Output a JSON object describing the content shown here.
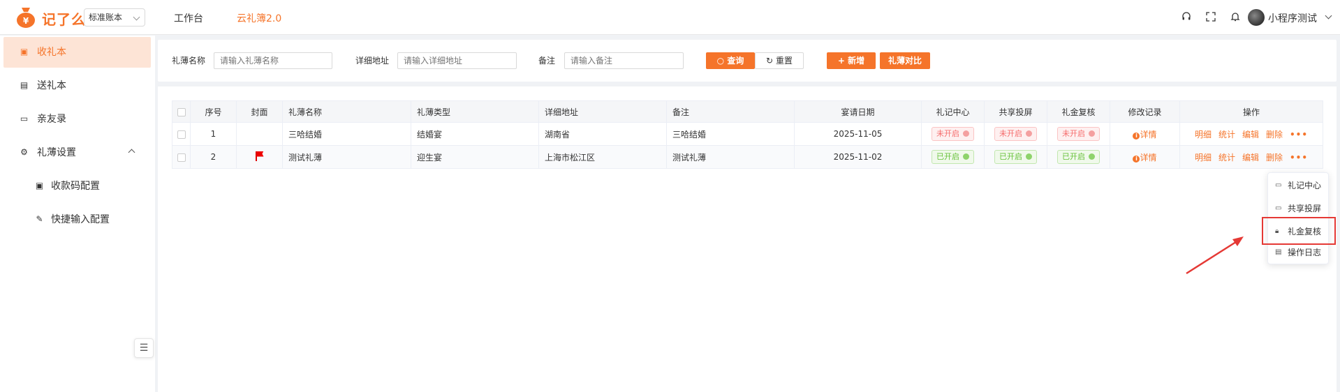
{
  "app": {
    "logo_text": "记了么",
    "book_select": "标准账本",
    "accent_color": "#f5742a"
  },
  "nav": {
    "workspace": "工作台",
    "current": "云礼簿2.0"
  },
  "header": {
    "icons": [
      "headset-icon",
      "fullscreen-icon",
      "bell-icon"
    ],
    "user_name": "小程序测试"
  },
  "sidebar": {
    "items": [
      {
        "label": "收礼本",
        "icon": "gift-book-icon",
        "active": true
      },
      {
        "label": "送礼本",
        "icon": "send-book-icon"
      },
      {
        "label": "亲友录",
        "icon": "folder-icon"
      },
      {
        "label": "礼薄设置",
        "icon": "gear-icon",
        "expanded": true
      },
      {
        "label": "收款码配置",
        "icon": "qrcode-icon",
        "sub": true
      },
      {
        "label": "快捷输入配置",
        "icon": "edit-icon",
        "sub": true
      }
    ]
  },
  "search": {
    "name_label": "礼薄名称",
    "name_placeholder": "请输入礼薄名称",
    "address_label": "详细地址",
    "address_placeholder": "请输入详细地址",
    "remark_label": "备注",
    "remark_placeholder": "请输入备注",
    "query_button": "查询",
    "reset_button": "重置",
    "add_button": "新增",
    "compare_button": "礼薄对比"
  },
  "table": {
    "columns": [
      "序号",
      "封面",
      "礼薄名称",
      "礼薄类型",
      "详细地址",
      "备注",
      "宴请日期",
      "礼记中心",
      "共享投屏",
      "礼金复核",
      "修改记录",
      "操作"
    ],
    "rows": [
      {
        "index": "1",
        "cover": "",
        "name": "三哈结婚",
        "type": "结婚宴",
        "address": "湖南省",
        "remark": "三哈结婚",
        "date": "2025-11-05",
        "center": "未开启",
        "share": "未开启",
        "review": "未开启",
        "record": "详情"
      },
      {
        "index": "2",
        "cover": "red-flag",
        "name": "测试礼薄",
        "type": "迎生宴",
        "address": "上海市松江区",
        "remark": "测试礼薄",
        "date": "2025-11-02",
        "center": "已开启",
        "share": "已开启",
        "review": "已开启",
        "record": "详情"
      }
    ],
    "actions": [
      "明细",
      "统计",
      "编辑",
      "删除"
    ],
    "more": "•••"
  },
  "dropdown": {
    "items": [
      {
        "label": "礼记中心",
        "icon": "screen-icon"
      },
      {
        "label": "共享投屏",
        "icon": "monitor-icon"
      },
      {
        "label": "礼金复核",
        "icon": "lock-icon"
      },
      {
        "label": "操作日志",
        "icon": "document-icon"
      }
    ]
  }
}
